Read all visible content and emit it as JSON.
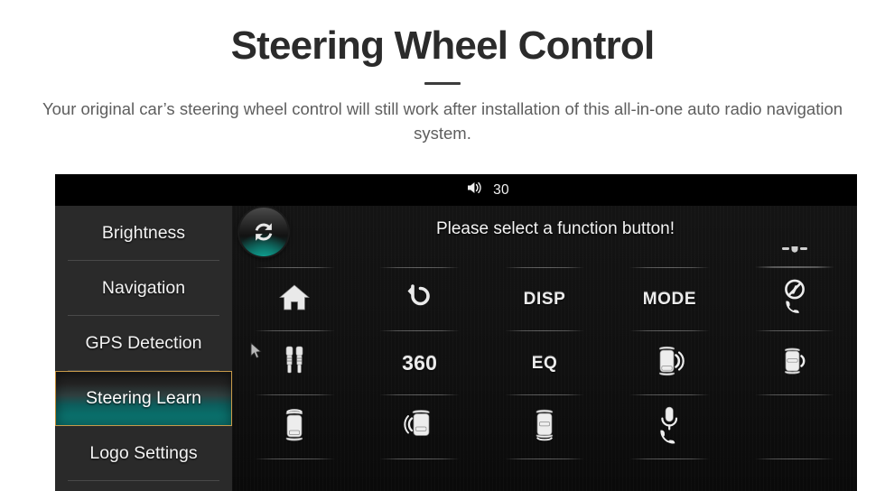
{
  "hero": {
    "title": "Steering Wheel Control",
    "subtitle": "Your original car’s steering wheel control will still work after installation of this all-in-one auto radio navigation system."
  },
  "device": {
    "statusbar": {
      "volume_icon": "speaker-icon",
      "volume_value": "30"
    },
    "sidebar": {
      "items": [
        {
          "label": "Brightness",
          "selected": false
        },
        {
          "label": "Navigation",
          "selected": false
        },
        {
          "label": "GPS Detection",
          "selected": false
        },
        {
          "label": "Steering Learn",
          "selected": true
        },
        {
          "label": "Logo Settings",
          "selected": false
        }
      ]
    },
    "main": {
      "sync_button_icon": "refresh-sync-icon",
      "title": "Please select a function button!",
      "grid": {
        "rows": [
          {
            "partial": true,
            "cells": [
              {
                "type": "empty",
                "icon": "",
                "label": ""
              },
              {
                "type": "empty",
                "icon": "",
                "label": ""
              },
              {
                "type": "empty",
                "icon": "",
                "label": ""
              },
              {
                "type": "empty",
                "icon": "",
                "label": ""
              },
              {
                "type": "icon",
                "icon": "car-top-clipped-icon",
                "label": ""
              }
            ]
          },
          {
            "partial": false,
            "cells": [
              {
                "type": "icon",
                "icon": "home-icon",
                "label": ""
              },
              {
                "type": "icon",
                "icon": "back-arrow-icon",
                "label": ""
              },
              {
                "type": "text",
                "icon": "",
                "label": "DISP"
              },
              {
                "type": "text",
                "icon": "",
                "label": "MODE"
              },
              {
                "type": "icon",
                "icon": "phone-hangup-icon",
                "label": ""
              }
            ]
          },
          {
            "partial": false,
            "cells": [
              {
                "type": "icon",
                "icon": "audio-jacks-icon",
                "label": ""
              },
              {
                "type": "text-big",
                "icon": "",
                "label": "360"
              },
              {
                "type": "text",
                "icon": "",
                "label": "EQ"
              },
              {
                "type": "icon",
                "icon": "car-volume-up-icon",
                "label": ""
              },
              {
                "type": "icon",
                "icon": "car-volume-down-icon",
                "label": ""
              }
            ]
          },
          {
            "partial": false,
            "cells": [
              {
                "type": "icon",
                "icon": "car-seek-up-icon",
                "label": ""
              },
              {
                "type": "icon",
                "icon": "car-side-left-icon",
                "label": ""
              },
              {
                "type": "icon",
                "icon": "car-seek-down-icon",
                "label": ""
              },
              {
                "type": "icon",
                "icon": "voice-call-mic-icon",
                "label": ""
              },
              {
                "type": "empty",
                "icon": "",
                "label": ""
              }
            ]
          }
        ]
      }
    },
    "cursor": {
      "icon": "mouse-pointer-icon"
    }
  },
  "colors": {
    "accent_teal": "#0d7d78",
    "selection_border": "#c79a4a",
    "panel_bg": "#101010",
    "sidebar_bg": "#2a2a2a",
    "text_light": "#f3f3f3",
    "heading": "#2b2b2b",
    "body_text": "#5e5e5e"
  }
}
